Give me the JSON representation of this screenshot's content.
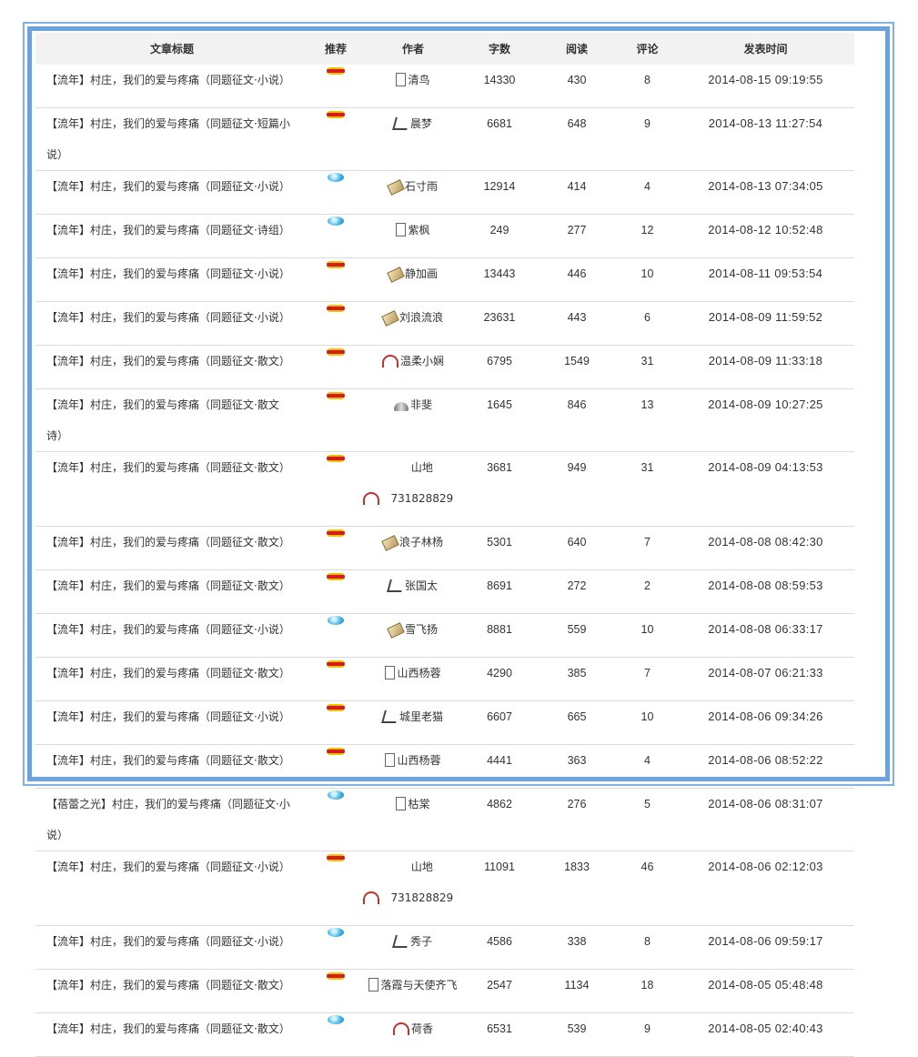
{
  "headers": {
    "title": "文章标题",
    "recommend": "推荐",
    "author": "作者",
    "words": "字数",
    "reads": "阅读",
    "comments": "评论",
    "time": "发表时间"
  },
  "rows": [
    {
      "title_line1": "【流年】村庄，我们的爱与疼痛（同题征文·小说）",
      "title_line2": "",
      "rec": "red-badge-icon",
      "author_icon": "document-icon",
      "author": "清鸟",
      "words": "14330",
      "reads": "430",
      "comments": "8",
      "time": "2014-08-15 09:19:55"
    },
    {
      "title_line1": "【流年】村庄，我们的爱与疼痛（同题征文·短篇小",
      "title_line2": "说）",
      "rec": "red-badge-icon",
      "author_icon": "quill-icon",
      "author": "晨梦",
      "words": "6681",
      "reads": "648",
      "comments": "9",
      "time": "2014-08-13 11:27:54"
    },
    {
      "title_line1": "【流年】村庄，我们的爱与疼痛（同题征文·小说）",
      "title_line2": "",
      "rec": "blue-gem-icon",
      "author_icon": "scroll-icon",
      "author": "石寸雨",
      "words": "12914",
      "reads": "414",
      "comments": "4",
      "time": "2014-08-13 07:34:05"
    },
    {
      "title_line1": "【流年】村庄，我们的爱与疼痛（同题征文·诗组）",
      "title_line2": "",
      "rec": "blue-gem-icon",
      "author_icon": "document-icon",
      "author": "紫枫",
      "words": "249",
      "reads": "277",
      "comments": "12",
      "time": "2014-08-12 10:52:48"
    },
    {
      "title_line1": "【流年】村庄，我们的爱与疼痛（同题征文·小说）",
      "title_line2": "",
      "rec": "red-badge-icon",
      "author_icon": "scroll-icon",
      "author": "静加画",
      "words": "13443",
      "reads": "446",
      "comments": "10",
      "time": "2014-08-11 09:53:54"
    },
    {
      "title_line1": "【流年】村庄，我们的爱与疼痛（同题征文·小说）",
      "title_line2": "",
      "rec": "red-badge-icon",
      "author_icon": "scroll-icon",
      "author": "刘浪流浪",
      "words": "23631",
      "reads": "443",
      "comments": "6",
      "time": "2014-08-09 11:59:52"
    },
    {
      "title_line1": "【流年】村庄，我们的爱与疼痛（同题征文·散文）",
      "title_line2": "",
      "rec": "red-badge-icon",
      "author_icon": "fan-icon",
      "author": "温柔小娴",
      "words": "6795",
      "reads": "1549",
      "comments": "31",
      "time": "2014-08-09 11:33:18"
    },
    {
      "title_line1": "【流年】村庄，我们的爱与疼痛（同题征文·散文",
      "title_line2": "诗）",
      "rec": "red-badge-icon",
      "author_icon": "folding-fan-icon",
      "author": "非斐",
      "words": "1645",
      "reads": "846",
      "comments": "13",
      "time": "2014-08-09 10:27:25"
    },
    {
      "title_line1": "【流年】村庄，我们的爱与疼痛（同题征文·散文）",
      "title_line2": "",
      "rec": "red-badge-icon",
      "author_icon": "fan-icon",
      "author": "山地731828829",
      "words": "3681",
      "reads": "949",
      "comments": "31",
      "time": "2014-08-09 04:13:53"
    },
    {
      "title_line1": "【流年】村庄，我们的爱与疼痛（同题征文·散文）",
      "title_line2": "",
      "rec": "red-badge-icon",
      "author_icon": "scroll-icon",
      "author": "浪子林杨",
      "words": "5301",
      "reads": "640",
      "comments": "7",
      "time": "2014-08-08 08:42:30"
    },
    {
      "title_line1": "【流年】村庄，我们的爱与疼痛（同题征文·散文）",
      "title_line2": "",
      "rec": "red-badge-icon",
      "author_icon": "quill-icon",
      "author": "张国太",
      "words": "8691",
      "reads": "272",
      "comments": "2",
      "time": "2014-08-08 08:59:53"
    },
    {
      "title_line1": "【流年】村庄，我们的爱与疼痛（同题征文·小说）",
      "title_line2": "",
      "rec": "blue-gem-icon",
      "author_icon": "scroll-icon",
      "author": "雪飞扬",
      "words": "8881",
      "reads": "559",
      "comments": "10",
      "time": "2014-08-08 06:33:17"
    },
    {
      "title_line1": "【流年】村庄，我们的爱与疼痛（同题征文·散文）",
      "title_line2": "",
      "rec": "red-badge-icon",
      "author_icon": "document-icon",
      "author": "山西杨蓉",
      "words": "4290",
      "reads": "385",
      "comments": "7",
      "time": "2014-08-07 06:21:33"
    },
    {
      "title_line1": "【流年】村庄，我们的爱与疼痛（同题征文·小说）",
      "title_line2": "",
      "rec": "red-badge-icon",
      "author_icon": "quill-icon",
      "author": "城里老猫",
      "words": "6607",
      "reads": "665",
      "comments": "10",
      "time": "2014-08-06 09:34:26"
    },
    {
      "title_line1": "【流年】村庄，我们的爱与疼痛（同题征文·散文）",
      "title_line2": "",
      "rec": "red-badge-icon",
      "author_icon": "document-icon",
      "author": "山西杨蓉",
      "words": "4441",
      "reads": "363",
      "comments": "4",
      "time": "2014-08-06 08:52:22"
    },
    {
      "title_line1": "【蓓蕾之光】村庄，我们的爱与疼痛（同题征文·小",
      "title_line2": "说）",
      "rec": "blue-gem-icon",
      "author_icon": "document-icon",
      "author": "枯棠",
      "words": "4862",
      "reads": "276",
      "comments": "5",
      "time": "2014-08-06 08:31:07"
    },
    {
      "title_line1": "【流年】村庄，我们的爱与疼痛（同题征文·小说）",
      "title_line2": "",
      "rec": "red-badge-icon",
      "author_icon": "fan-icon",
      "author": "山地731828829",
      "words": "11091",
      "reads": "1833",
      "comments": "46",
      "time": "2014-08-06 02:12:03"
    },
    {
      "title_line1": "【流年】村庄，我们的爱与疼痛（同题征文·小说）",
      "title_line2": "",
      "rec": "blue-gem-icon",
      "author_icon": "quill-icon",
      "author": "秀子",
      "words": "4586",
      "reads": "338",
      "comments": "8",
      "time": "2014-08-06 09:59:17"
    },
    {
      "title_line1": "【流年】村庄，我们的爱与疼痛（同题征文·散文）",
      "title_line2": "",
      "rec": "red-badge-icon",
      "author_icon": "document-icon",
      "author": "落霞与天使齐飞",
      "words": "2547",
      "reads": "1134",
      "comments": "18",
      "time": "2014-08-05 05:48:48"
    },
    {
      "title_line1": "【流年】村庄，我们的爱与疼痛（同题征文·散文）",
      "title_line2": "",
      "rec": "blue-gem-icon",
      "author_icon": "fan-icon",
      "author": "荷香",
      "words": "6531",
      "reads": "539",
      "comments": "9",
      "time": "2014-08-05 02:40:43"
    }
  ]
}
